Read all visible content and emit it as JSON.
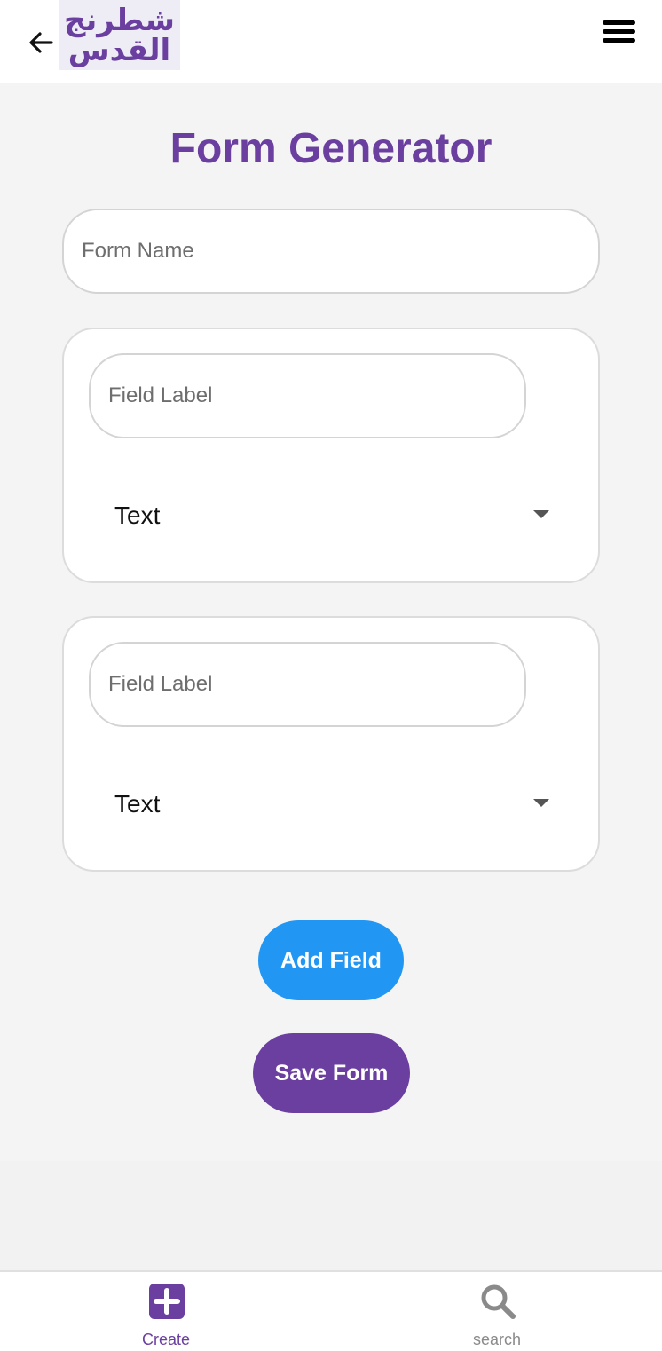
{
  "header": {
    "logo_text_line1": "شطرنج",
    "logo_text_line2": "القدس",
    "back_icon": "arrow-left-icon",
    "menu_icon": "hamburger-menu-icon"
  },
  "main": {
    "title": "Form Generator",
    "form_name": {
      "placeholder": "Form Name",
      "value": ""
    },
    "fields": [
      {
        "label_placeholder": "Field Label",
        "label_value": "",
        "type_value": "Text"
      },
      {
        "label_placeholder": "Field Label",
        "label_value": "",
        "type_value": "Text"
      }
    ],
    "add_field_label": "Add Field",
    "save_form_label": "Save Form"
  },
  "bottom_nav": {
    "items": [
      {
        "label": "Create",
        "icon": "plus-square-icon",
        "active": true
      },
      {
        "label": "search",
        "icon": "search-icon",
        "active": false
      }
    ]
  },
  "colors": {
    "primary": "#6b3fa0",
    "accent_blue": "#2196f3",
    "background": "#f4f4f4"
  }
}
